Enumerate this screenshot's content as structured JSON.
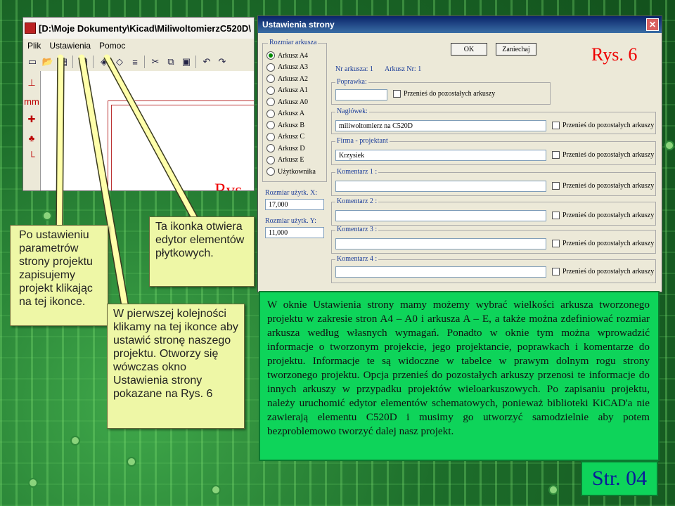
{
  "kicad_window": {
    "title": "[D:\\Moje Dokumenty\\Kicad\\MiliwoltomierzC520D\\",
    "menu": [
      "Plik",
      "Ustawienia",
      "Pomoc"
    ],
    "figure_label": "Rys. 5"
  },
  "dialog": {
    "title": "Ustawienia strony",
    "figure_label": "Rys. 6",
    "size_group_label": "Rozmiar arkusza",
    "sizes": [
      "Arkusz A4",
      "Arkusz A3",
      "Arkusz A2",
      "Arkusz A1",
      "Arkusz A0",
      "Arkusz A",
      "Arkusz B",
      "Arkusz C",
      "Arkusz D",
      "Arkusz E",
      "Użytkownika"
    ],
    "selected_size": "Arkusz A4",
    "user_x_label": "Rozmiar użytk. X:",
    "user_x_value": "17,000",
    "user_y_label": "Rozmiar użytk. Y:",
    "user_y_value": "11,000",
    "ok_label": "OK",
    "cancel_label": "Zaniechaj",
    "sheet_number": "Nr arkusza: 1",
    "sheet_count": "Arkusz Nr: 1",
    "revision_label": "Poprawka:",
    "revision_value": "",
    "title_label": "Nagłówek:",
    "title_value": "miliwoltomierz na C520D",
    "company_label": "Firma - projektant",
    "company_value": "Krzysiek",
    "comment1_label": "Komentarz 1 :",
    "comment2_label": "Komentarz 2 :",
    "comment3_label": "Komentarz 3 :",
    "comment4_label": "Komentarz 4 :",
    "copy_label": "Przenieś do pozostałych arkuszy"
  },
  "callouts": {
    "left": "Po ustawieniu parametrów strony projektu zapisujemy projekt klikając na tej ikonce.",
    "mid": "Ta ikonka otwiera edytor elementów płytkowych.",
    "main": "W pierwszej kolejności klikamy na tej ikonce aby ustawić stronę naszego projektu. Otworzy się wówczas okno Ustawienia strony pokazane na Rys. 6"
  },
  "description": "W oknie Ustawienia strony mamy możemy wybrać wielkości arkusza tworzonego projektu w zakresie stron A4 – A0 i arkusza A – E, a także można zdefiniować rozmiar arkusza według własnych wymagań. Ponadto w oknie tym można wprowadzić informacje o tworzonym projekcie, jego projektancie, poprawkach i komentarze do projektu. Informacje te są widoczne w tabelce w prawym dolnym rogu strony tworzonego projektu. Opcja przenieś do pozostałych arkuszy przenosi te informacje do innych arkuszy w przypadku projektów wieloarkuszowych. Po zapisaniu projektu, należy uruchomić edytor elementów schematowych, ponieważ biblioteki KiCAD'a nie zawierają elementu C520D i musimy go utworzyć samodzielnie aby potem bezproblemowo tworzyć dalej nasz projekt.",
  "page_label": "Str. 04",
  "colors": {
    "callout_bg": "#eef7a6",
    "desc_bg": "#0ed45a",
    "label_red": "#e00000",
    "page_blue": "#0a1a9a"
  }
}
